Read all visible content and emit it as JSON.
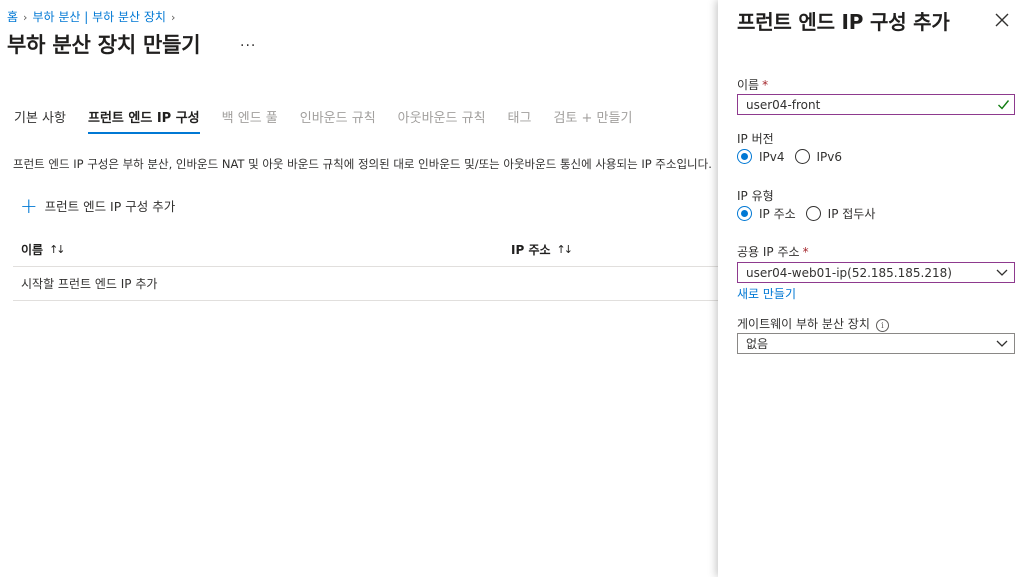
{
  "breadcrumb": {
    "items": [
      "홈",
      "부하 분산 | 부하 분산 장치"
    ]
  },
  "page": {
    "title": "부하 분산 장치 만들기",
    "more_label": "..."
  },
  "tabs": [
    {
      "label": "기본 사항"
    },
    {
      "label": "프런트 엔드 IP 구성"
    },
    {
      "label": "백 엔드 풀"
    },
    {
      "label": "인바운드 규칙"
    },
    {
      "label": "아웃바운드 규칙"
    },
    {
      "label": "태그"
    },
    {
      "label": "검토 + 만들기"
    }
  ],
  "description": "프런트 엔드 IP 구성은 부하 분산, 인바운드 NAT 및 아웃 바운드 규칙에 정의된 대로 인바운드 및/또는 아웃바운드 통신에 사용되는 IP 주소입니다.",
  "add_button": {
    "label": "프런트 엔드 IP 구성 추가"
  },
  "table": {
    "columns": [
      "이름",
      "IP 주소"
    ],
    "empty_row": "시작할 프런트 엔드 IP 추가"
  },
  "panel": {
    "title": "프런트 엔드 IP 구성 추가",
    "name_label": "이름",
    "name_value": "user04-front",
    "ip_version_label": "IP 버전",
    "ip_version_options": [
      "IPv4",
      "IPv6"
    ],
    "ip_version_selected": "IPv4",
    "ip_type_label": "IP 유형",
    "ip_type_options": [
      "IP 주소",
      "IP 접두사"
    ],
    "ip_type_selected": "IP 주소",
    "public_ip_label": "공용 IP 주소",
    "public_ip_value": "user04-web01-ip(52.185.185.218)",
    "create_new_link": "새로 만들기",
    "gateway_label": "게이트웨이 부하 분산 장치",
    "gateway_value": "없음",
    "required_marker": "*"
  },
  "colors": {
    "accent": "#0078d4",
    "required": "#a4262c",
    "valid": "#107c10"
  }
}
